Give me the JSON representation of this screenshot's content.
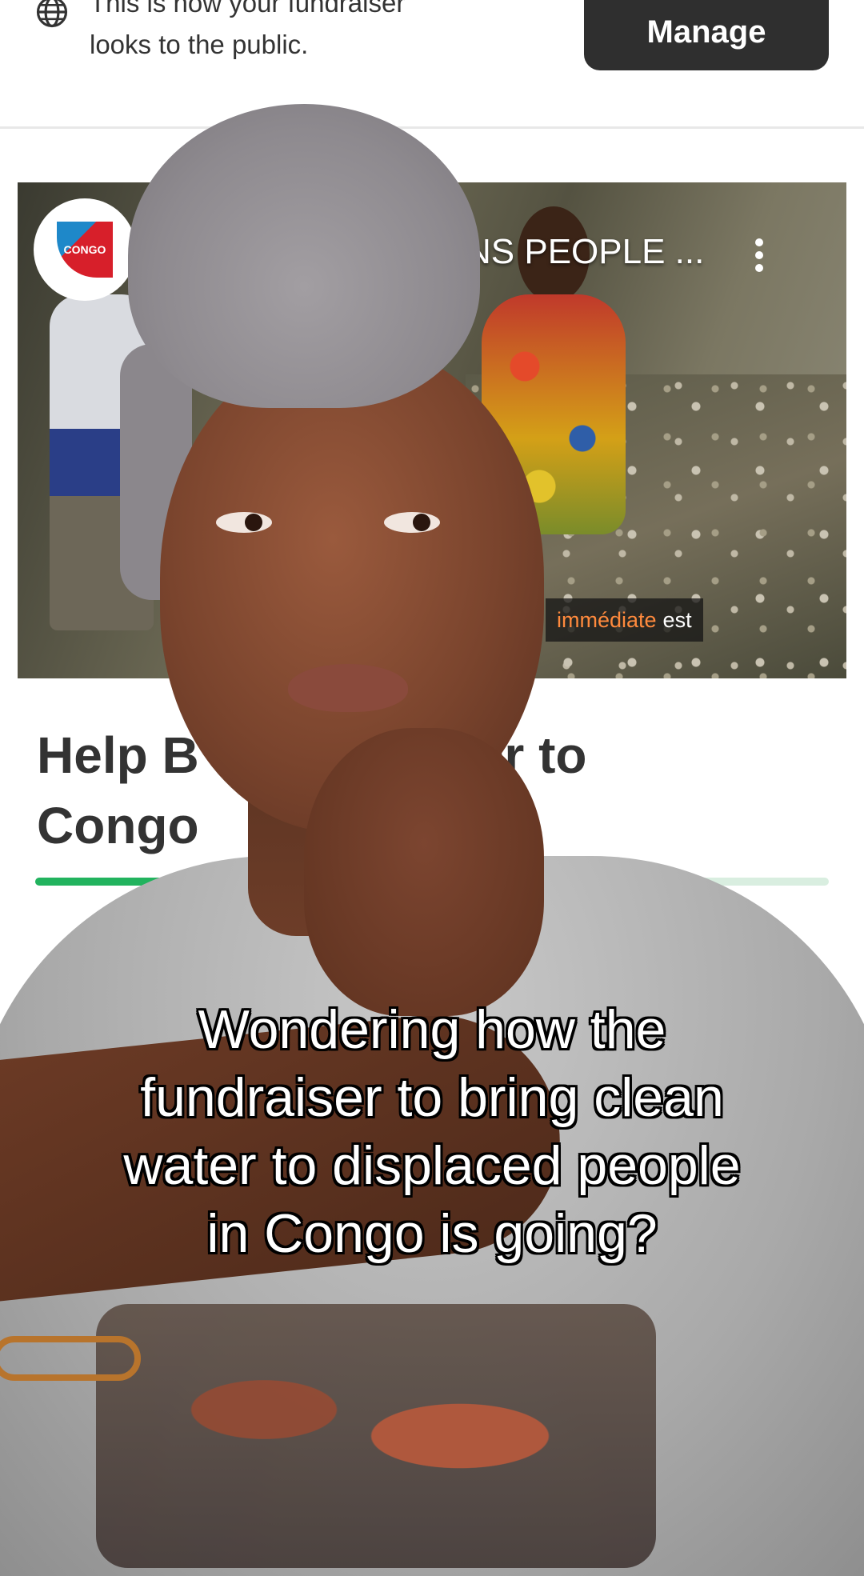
{
  "notice": {
    "text_line1": "This is how your fundraiser",
    "text_line2": "looks to the public.",
    "icon": "globe-icon",
    "manage_label": "Manage"
  },
  "video": {
    "channel_logo_text": "CONGO",
    "title": "NS PEOPLE ...",
    "caption_highlight": "immédiate",
    "caption_rest": "est",
    "menu_icon": "more-vertical-icon"
  },
  "fundraiser": {
    "title_line1": "Help B             Water to",
    "title_line2": "Congo",
    "progress_fraction": 0.78,
    "progress_color": "#22b35e"
  },
  "overlay": {
    "lines": [
      "Wondering how the",
      "fundraiser to bring clean",
      "water to displaced people",
      "in Congo is going?"
    ]
  }
}
